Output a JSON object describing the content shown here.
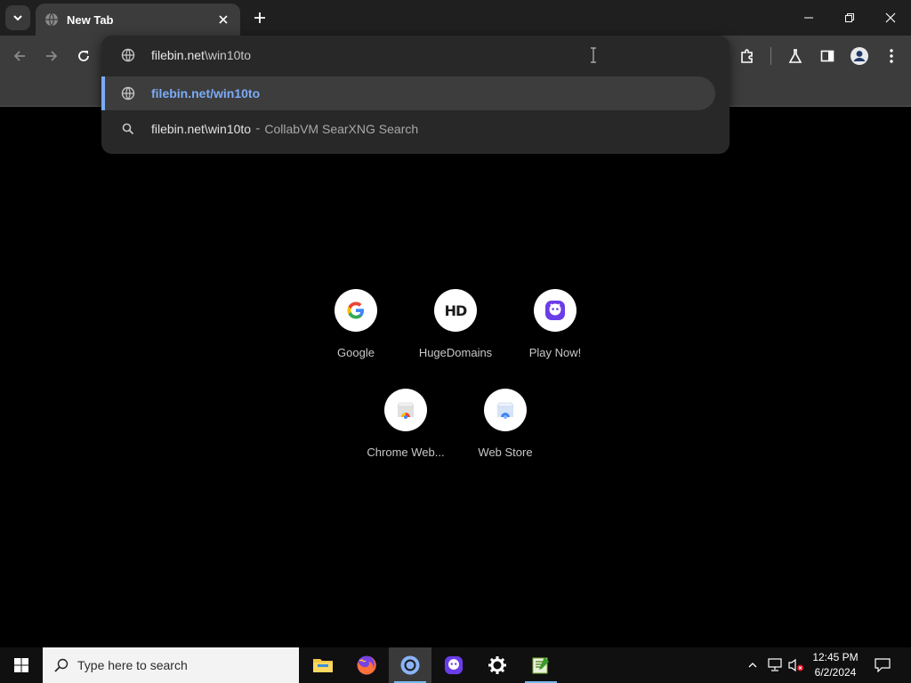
{
  "browser": {
    "tab": {
      "title": "New Tab"
    }
  },
  "omnibox": {
    "input_value_bold": "filebin.net",
    "input_value_rest": "\\win10to",
    "suggestions": [
      {
        "main": "filebin.net/win10to",
        "secondary": ""
      },
      {
        "main": "filebin.net\\win10to",
        "separator": "-",
        "secondary": "CollabVM SearXNG Search"
      }
    ]
  },
  "shortcuts": [
    {
      "label": "Google"
    },
    {
      "label": "HugeDomains"
    },
    {
      "label": "Play Now!"
    },
    {
      "label": "Chrome Web..."
    },
    {
      "label": "Web Store"
    }
  ],
  "shortcut_icons": {
    "hd_text": "HD",
    "google_letter": "G"
  },
  "taskbar": {
    "search_placeholder": "Type here to search",
    "time": "12:45 PM",
    "date": "6/2/2024"
  },
  "colors": {
    "accent_link": "#7cacf8",
    "taskbar_active_underline": "#76b9ed"
  }
}
